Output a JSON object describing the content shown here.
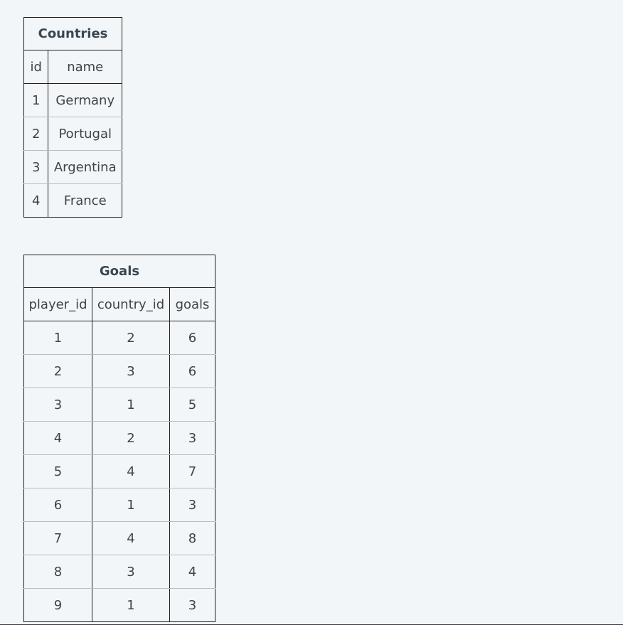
{
  "countries": {
    "title": "Countries",
    "columns": [
      "id",
      "name"
    ],
    "rows": [
      [
        "1",
        "Germany"
      ],
      [
        "2",
        "Portugal"
      ],
      [
        "3",
        "Argentina"
      ],
      [
        "4",
        "France"
      ]
    ]
  },
  "goals": {
    "title": "Goals",
    "columns": [
      "player_id",
      "country_id",
      "goals"
    ],
    "rows": [
      [
        "1",
        "2",
        "6"
      ],
      [
        "2",
        "3",
        "6"
      ],
      [
        "3",
        "1",
        "5"
      ],
      [
        "4",
        "2",
        "3"
      ],
      [
        "5",
        "4",
        "7"
      ],
      [
        "6",
        "1",
        "3"
      ],
      [
        "7",
        "4",
        "8"
      ],
      [
        "8",
        "3",
        "4"
      ],
      [
        "9",
        "1",
        "3"
      ]
    ]
  }
}
